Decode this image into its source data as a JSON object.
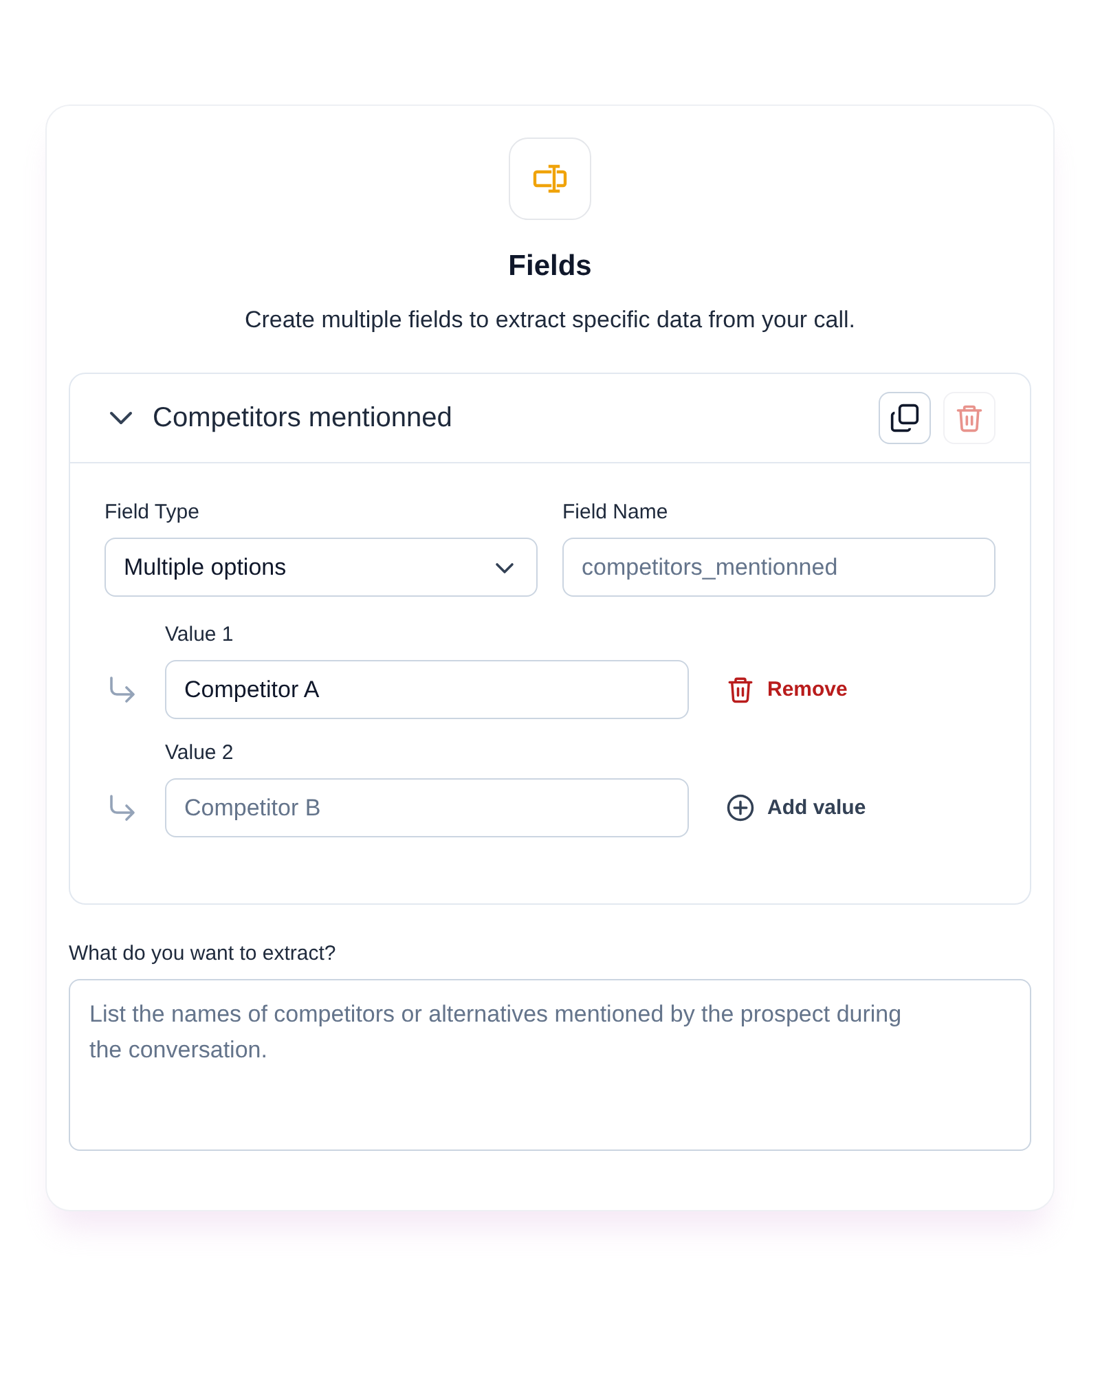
{
  "header": {
    "title": "Fields",
    "description": "Create multiple fields to extract specific data from your call."
  },
  "field_panel": {
    "title": "Competitors mentionned",
    "expanded": true,
    "actions": [
      {
        "kind": "duplicate",
        "disabled": false
      },
      {
        "kind": "delete",
        "disabled": true
      }
    ],
    "field_type": {
      "label": "Field Type",
      "value": "Multiple options"
    },
    "field_name": {
      "label": "Field Name",
      "placeholder": "competitors_mentionned"
    },
    "values": [
      {
        "label": "Value 1",
        "value": "Competitor A",
        "action": {
          "kind": "remove",
          "label": "Remove"
        }
      },
      {
        "label": "Value 2",
        "placeholder": "Competitor B",
        "action": {
          "kind": "add",
          "label": "Add value"
        }
      }
    ]
  },
  "extract": {
    "label": "What do you want to extract?",
    "placeholder": "List the names of competitors or alternatives mentioned by the prospect during the conversation."
  }
}
